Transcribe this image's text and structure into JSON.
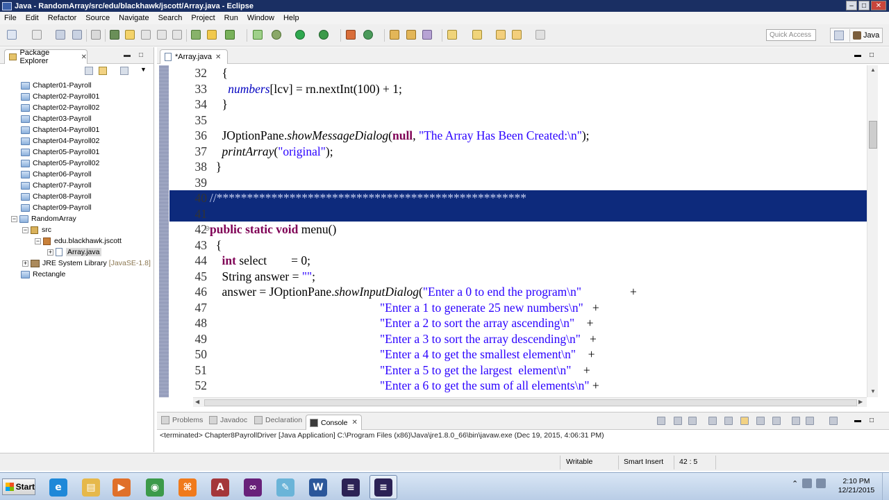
{
  "window": {
    "title": "Java - RandomArray/src/edu/blackhawk/jscott/Array.java - Eclipse",
    "min": "–",
    "max": "□",
    "close": "✕"
  },
  "menu": [
    "File",
    "Edit",
    "Refactor",
    "Source",
    "Navigate",
    "Search",
    "Project",
    "Run",
    "Window",
    "Help"
  ],
  "toolbar": {
    "quick_access_placeholder": "Quick Access",
    "perspective_label": "Java"
  },
  "package_explorer": {
    "tab_label": "Package Explorer",
    "tab_close": "✕",
    "items": [
      {
        "label": "Chapter01-Payroll"
      },
      {
        "label": "Chapter02-Payroll01"
      },
      {
        "label": "Chapter02-Payroll02"
      },
      {
        "label": "Chapter03-Payroll"
      },
      {
        "label": "Chapter04-Payroll01"
      },
      {
        "label": "Chapter04-Payroll02"
      },
      {
        "label": "Chapter05-Payroll01"
      },
      {
        "label": "Chapter05-Payroll02"
      },
      {
        "label": "Chapter06-Payroll"
      },
      {
        "label": "Chapter07-Payroll"
      },
      {
        "label": "Chapter08-Payroll"
      },
      {
        "label": "Chapter09-Payroll"
      },
      {
        "label": "RandomArray"
      },
      {
        "label": "src"
      },
      {
        "label": "edu.blackhawk.jscott"
      },
      {
        "label": "Array.java"
      },
      {
        "label": "JRE System Library",
        "suffix": "[JavaSE-1.8]"
      },
      {
        "label": "Rectangle"
      }
    ]
  },
  "editor": {
    "tab_label": "*Array.java",
    "tab_close": "✕",
    "lines": [
      {
        "n": "32",
        "parts": [
          {
            "t": "    {",
            "c": ""
          }
        ]
      },
      {
        "n": "33",
        "parts": [
          {
            "t": "      ",
            "c": ""
          },
          {
            "t": "numbers",
            "c": "fld"
          },
          {
            "t": "[lcv] = rn.nextInt(100) + 1;",
            "c": ""
          }
        ]
      },
      {
        "n": "34",
        "parts": [
          {
            "t": "    }",
            "c": ""
          }
        ]
      },
      {
        "n": "35",
        "parts": [
          {
            "t": "",
            "c": ""
          }
        ]
      },
      {
        "n": "36",
        "parts": [
          {
            "t": "    JOptionPane.",
            "c": ""
          },
          {
            "t": "showMessageDialog",
            "c": "ital"
          },
          {
            "t": "(",
            "c": ""
          },
          {
            "t": "null",
            "c": "kw"
          },
          {
            "t": ", ",
            "c": ""
          },
          {
            "t": "\"The Array Has Been Created:\\n\"",
            "c": "str"
          },
          {
            "t": ");",
            "c": ""
          }
        ]
      },
      {
        "n": "37",
        "parts": [
          {
            "t": "    ",
            "c": ""
          },
          {
            "t": "printArray",
            "c": "ital"
          },
          {
            "t": "(",
            "c": ""
          },
          {
            "t": "\"original\"",
            "c": "str"
          },
          {
            "t": ");",
            "c": ""
          }
        ]
      },
      {
        "n": "38",
        "parts": [
          {
            "t": "  }",
            "c": ""
          }
        ]
      },
      {
        "n": "39",
        "parts": [
          {
            "t": "",
            "c": ""
          }
        ]
      },
      {
        "n": "40",
        "sel": true,
        "parts": [
          {
            "t": "//***************************************************",
            "c": "sel-text"
          }
        ]
      },
      {
        "n": "41",
        "sel": true,
        "parts": [
          {
            "t": "",
            "c": ""
          }
        ]
      },
      {
        "n": "42",
        "fold": true,
        "parts": [
          {
            "t": "public static void",
            "c": "kw"
          },
          {
            "t": " menu()",
            "c": ""
          }
        ]
      },
      {
        "n": "43",
        "parts": [
          {
            "t": "  {",
            "c": ""
          }
        ]
      },
      {
        "n": "44",
        "parts": [
          {
            "t": "    ",
            "c": ""
          },
          {
            "t": "int",
            "c": "kw"
          },
          {
            "t": " select        = 0;",
            "c": ""
          }
        ]
      },
      {
        "n": "45",
        "parts": [
          {
            "t": "    String answer = ",
            "c": ""
          },
          {
            "t": "\"\"",
            "c": "str"
          },
          {
            "t": ";",
            "c": ""
          }
        ]
      },
      {
        "n": "46",
        "parts": [
          {
            "t": "    answer = JOptionPane.",
            "c": ""
          },
          {
            "t": "showInputDialog",
            "c": "ital"
          },
          {
            "t": "(",
            "c": ""
          },
          {
            "t": "\"Enter a 0 to end the program\\n\"",
            "c": "str"
          },
          {
            "t": "                +",
            "c": ""
          }
        ]
      },
      {
        "n": "47",
        "parts": [
          {
            "t": "                                                        ",
            "c": ""
          },
          {
            "t": "\"Enter a 1 to generate 25 new numbers\\n\"",
            "c": "str"
          },
          {
            "t": "   +",
            "c": ""
          }
        ]
      },
      {
        "n": "48",
        "parts": [
          {
            "t": "                                                        ",
            "c": ""
          },
          {
            "t": "\"Enter a 2 to sort the array ascending\\n\"",
            "c": "str"
          },
          {
            "t": "    +",
            "c": ""
          }
        ]
      },
      {
        "n": "49",
        "parts": [
          {
            "t": "                                                        ",
            "c": ""
          },
          {
            "t": "\"Enter a 3 to sort the array descending\\n\"",
            "c": "str"
          },
          {
            "t": "   +",
            "c": ""
          }
        ]
      },
      {
        "n": "50",
        "parts": [
          {
            "t": "                                                        ",
            "c": ""
          },
          {
            "t": "\"Enter a 4 to get the smallest element\\n\"",
            "c": "str"
          },
          {
            "t": "    +",
            "c": ""
          }
        ]
      },
      {
        "n": "51",
        "parts": [
          {
            "t": "                                                        ",
            "c": ""
          },
          {
            "t": "\"Enter a 5 to get the largest  element\\n\"",
            "c": "str"
          },
          {
            "t": "    +",
            "c": ""
          }
        ]
      },
      {
        "n": "52",
        "parts": [
          {
            "t": "                                                        ",
            "c": ""
          },
          {
            "t": "\"Enter a 6 to get the sum of all elements\\n\"",
            "c": "str"
          },
          {
            "t": " +",
            "c": ""
          }
        ]
      }
    ]
  },
  "console": {
    "tabs": [
      "Problems",
      "Javadoc",
      "Declaration",
      "Console"
    ],
    "active_tab": "Console",
    "tab_close": "✕",
    "status_line": "<terminated> Chapter8PayrollDriver [Java Application] C:\\Program Files (x86)\\Java\\jre1.8.0_66\\bin\\javaw.exe (Dec 19, 2015, 4:06:31 PM)"
  },
  "statusbar": {
    "writable": "Writable",
    "insert_mode": "Smart Insert",
    "position": "42 : 5"
  },
  "taskbar": {
    "start_label": "Start",
    "apps": [
      {
        "icon": "internet-explorer-icon",
        "glyph": "e",
        "color": "#1e88d8"
      },
      {
        "icon": "file-explorer-icon",
        "glyph": "▤",
        "color": "#e6b84a"
      },
      {
        "icon": "media-player-icon",
        "glyph": "▶",
        "color": "#e0702a"
      },
      {
        "icon": "chrome-icon",
        "glyph": "◉",
        "color": "#3c9a4a"
      },
      {
        "icon": "xampp-icon",
        "glyph": "⌘",
        "color": "#f07a1c"
      },
      {
        "icon": "access-icon",
        "glyph": "A",
        "color": "#a4373a"
      },
      {
        "icon": "visual-studio-icon",
        "glyph": "∞",
        "color": "#68217a"
      },
      {
        "icon": "notepad-icon",
        "glyph": "✎",
        "color": "#6ab4d8"
      },
      {
        "icon": "word-icon",
        "glyph": "W",
        "color": "#2b579a"
      },
      {
        "icon": "eclipse-icon",
        "glyph": "≡",
        "color": "#2c2255"
      },
      {
        "icon": "eclipse-icon",
        "glyph": "≡",
        "color": "#2c2255",
        "active": true
      }
    ],
    "time": "2:10 PM",
    "date": "12/21/2015"
  }
}
